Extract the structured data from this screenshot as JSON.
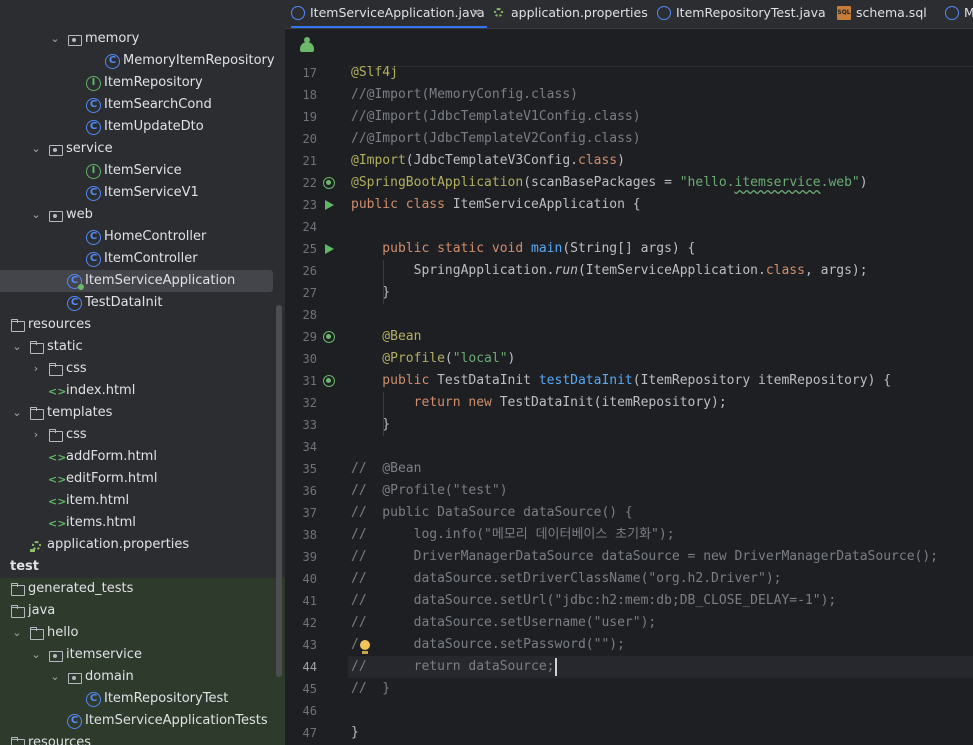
{
  "tabs": [
    {
      "label": "ItemServiceApplication.java",
      "icon": "spring-class-icon",
      "active": true,
      "closable": true
    },
    {
      "label": "application.properties",
      "icon": "properties-file-icon"
    },
    {
      "label": "ItemRepositoryTest.java",
      "icon": "class-icon"
    },
    {
      "label": "schema.sql",
      "icon": "sql-file-icon",
      "icon_text": "SQL"
    },
    {
      "label": "M",
      "icon": "class-icon"
    }
  ],
  "tree": [
    {
      "label": "memory",
      "icon": "package",
      "arrow": "⌄",
      "depth": 3
    },
    {
      "label": "MemoryItemRepository",
      "icon": "class",
      "depth": 5
    },
    {
      "label": "ItemRepository",
      "icon": "interface",
      "depth": 4
    },
    {
      "label": "ItemSearchCond",
      "icon": "class",
      "depth": 4
    },
    {
      "label": "ItemUpdateDto",
      "icon": "class",
      "depth": 4
    },
    {
      "label": "service",
      "icon": "package",
      "arrow": "⌄",
      "depth": 2
    },
    {
      "label": "ItemService",
      "icon": "interface",
      "depth": 4
    },
    {
      "label": "ItemServiceV1",
      "icon": "class",
      "depth": 4
    },
    {
      "label": "web",
      "icon": "package",
      "arrow": "⌄",
      "depth": 2
    },
    {
      "label": "HomeController",
      "icon": "class",
      "depth": 4
    },
    {
      "label": "ItemController",
      "icon": "class",
      "depth": 4
    },
    {
      "label": "ItemServiceApplication",
      "icon": "spring",
      "depth": 3,
      "selected": true
    },
    {
      "label": "TestDataInit",
      "icon": "class",
      "depth": 3
    },
    {
      "label": "resources",
      "icon": "folder",
      "depth": 0
    },
    {
      "label": "static",
      "icon": "folder",
      "arrow": "⌄",
      "depth": 1
    },
    {
      "label": "css",
      "icon": "folder",
      "arrow": "›",
      "depth": 2
    },
    {
      "label": "index.html",
      "icon": "html",
      "depth": 2
    },
    {
      "label": "templates",
      "icon": "folder",
      "arrow": "⌄",
      "depth": 1
    },
    {
      "label": "css",
      "icon": "folder",
      "arrow": "›",
      "depth": 2
    },
    {
      "label": "addForm.html",
      "icon": "html",
      "depth": 2
    },
    {
      "label": "editForm.html",
      "icon": "html",
      "depth": 2
    },
    {
      "label": "item.html",
      "icon": "html",
      "depth": 2
    },
    {
      "label": "items.html",
      "icon": "html",
      "depth": 2
    },
    {
      "label": "application.properties",
      "icon": "props",
      "depth": 1
    },
    {
      "label": "test",
      "icon": "none",
      "depth": -1,
      "bold": true
    },
    {
      "label": "generated_tests",
      "icon": "folder",
      "depth": 0,
      "test": true
    },
    {
      "label": "java",
      "icon": "folder",
      "depth": 0,
      "test": true
    },
    {
      "label": "hello",
      "icon": "folder",
      "arrow": "⌄",
      "depth": 1,
      "test": true
    },
    {
      "label": "itemservice",
      "icon": "package",
      "arrow": "⌄",
      "depth": 2,
      "test": true
    },
    {
      "label": "domain",
      "icon": "package",
      "arrow": "⌄",
      "depth": 3,
      "test": true
    },
    {
      "label": "ItemRepositoryTest",
      "icon": "class",
      "depth": 4,
      "test": true
    },
    {
      "label": "ItemServiceApplicationTests",
      "icon": "class",
      "depth": 3,
      "test": true
    },
    {
      "label": "resources",
      "icon": "folder",
      "depth": 0,
      "test": true
    }
  ],
  "editor": {
    "current_line": "44",
    "lines": [
      {
        "n": "17",
        "tokens": [
          [
            "@Slf4j",
            "ann"
          ]
        ]
      },
      {
        "n": "18",
        "tokens": [
          [
            "//@Import(MemoryConfig.class)",
            "cmt"
          ]
        ]
      },
      {
        "n": "19",
        "tokens": [
          [
            "//@Import(JdbcTemplateV1Config.class)",
            "cmt"
          ]
        ]
      },
      {
        "n": "20",
        "tokens": [
          [
            "//@Import(JdbcTemplateV2Config.class)",
            "cmt"
          ]
        ]
      },
      {
        "n": "21",
        "tokens": [
          [
            "@Import",
            "ann"
          ],
          [
            "(JdbcTemplateV3Config.",
            ""
          ],
          [
            "class",
            "kw"
          ],
          [
            ")",
            ""
          ]
        ]
      },
      {
        "n": "22",
        "gutter": "bean",
        "tokens": [
          [
            "@SpringBootApplication",
            "ann"
          ],
          [
            "(scanBasePackages = ",
            ""
          ],
          [
            "\"hello.",
            "str"
          ],
          [
            "itemservice",
            "str wavy"
          ],
          [
            ".web\"",
            "str"
          ],
          [
            ")",
            ""
          ]
        ]
      },
      {
        "n": "23",
        "gutter": "run",
        "tokens": [
          [
            "public class ",
            "kw"
          ],
          [
            "ItemServiceApplication {",
            ""
          ]
        ]
      },
      {
        "n": "24",
        "tokens": []
      },
      {
        "n": "25",
        "gutter": "run",
        "tokens": [
          [
            "    public static void ",
            "kw"
          ],
          [
            "main",
            "fn"
          ],
          [
            "(String[] args) {",
            ""
          ]
        ]
      },
      {
        "n": "26",
        "tokens": [
          [
            "        SpringApplication.",
            ""
          ],
          [
            "run",
            "it"
          ],
          [
            "(ItemServiceApplication.",
            ""
          ],
          [
            "class",
            "kw"
          ],
          [
            ", args);",
            ""
          ]
        ]
      },
      {
        "n": "27",
        "tokens": [
          [
            "    }",
            ""
          ]
        ]
      },
      {
        "n": "28",
        "tokens": []
      },
      {
        "n": "29",
        "gutter": "bean",
        "tokens": [
          [
            "    @Bean",
            "ann"
          ]
        ]
      },
      {
        "n": "30",
        "tokens": [
          [
            "    @Profile",
            "ann"
          ],
          [
            "(",
            ""
          ],
          [
            "\"local\"",
            "str"
          ],
          [
            ")",
            ""
          ]
        ]
      },
      {
        "n": "31",
        "gutter": "bean",
        "tokens": [
          [
            "    public ",
            "kw"
          ],
          [
            "TestDataInit ",
            ""
          ],
          [
            "testDataInit",
            "fn"
          ],
          [
            "(ItemRepository itemRepository) {",
            ""
          ]
        ]
      },
      {
        "n": "32",
        "tokens": [
          [
            "        return new ",
            "kw"
          ],
          [
            "TestDataInit(itemRepository);",
            ""
          ]
        ]
      },
      {
        "n": "33",
        "tokens": [
          [
            "    }",
            ""
          ]
        ]
      },
      {
        "n": "34",
        "tokens": []
      },
      {
        "n": "35",
        "tokens": [
          [
            "//  @Bean",
            "cmt"
          ]
        ]
      },
      {
        "n": "36",
        "tokens": [
          [
            "//  @Profile(\"test\")",
            "cmt"
          ]
        ]
      },
      {
        "n": "37",
        "tokens": [
          [
            "//  public DataSource dataSource() {",
            "cmt"
          ]
        ]
      },
      {
        "n": "38",
        "tokens": [
          [
            "//      log.info(\"메모리 데이터베이스 초기화\");",
            "cmt"
          ]
        ]
      },
      {
        "n": "39",
        "tokens": [
          [
            "//      DriverManagerDataSource dataSource = new DriverManagerDataSource();",
            "cmt"
          ]
        ]
      },
      {
        "n": "40",
        "tokens": [
          [
            "//      dataSource.setDriverClassName(\"org.h2.Driver\");",
            "cmt"
          ]
        ]
      },
      {
        "n": "41",
        "tokens": [
          [
            "//      dataSource.setUrl(\"jdbc:h2:mem:db;DB_CLOSE_DELAY=-1\");",
            "cmt"
          ]
        ]
      },
      {
        "n": "42",
        "tokens": [
          [
            "//      dataSource.setUsername(\"user\");",
            "cmt"
          ]
        ]
      },
      {
        "n": "43",
        "tokens": [
          [
            "/       dataSource.setPassword(\"\");",
            "cmt"
          ]
        ]
      },
      {
        "n": "44",
        "tokens": [
          [
            "//      return dataSource;",
            "cmt"
          ]
        ],
        "caret": true
      },
      {
        "n": "45",
        "tokens": [
          [
            "//  }",
            "cmt"
          ]
        ]
      },
      {
        "n": "46",
        "tokens": []
      },
      {
        "n": "47",
        "tokens": [
          [
            "}",
            ""
          ]
        ]
      }
    ]
  }
}
